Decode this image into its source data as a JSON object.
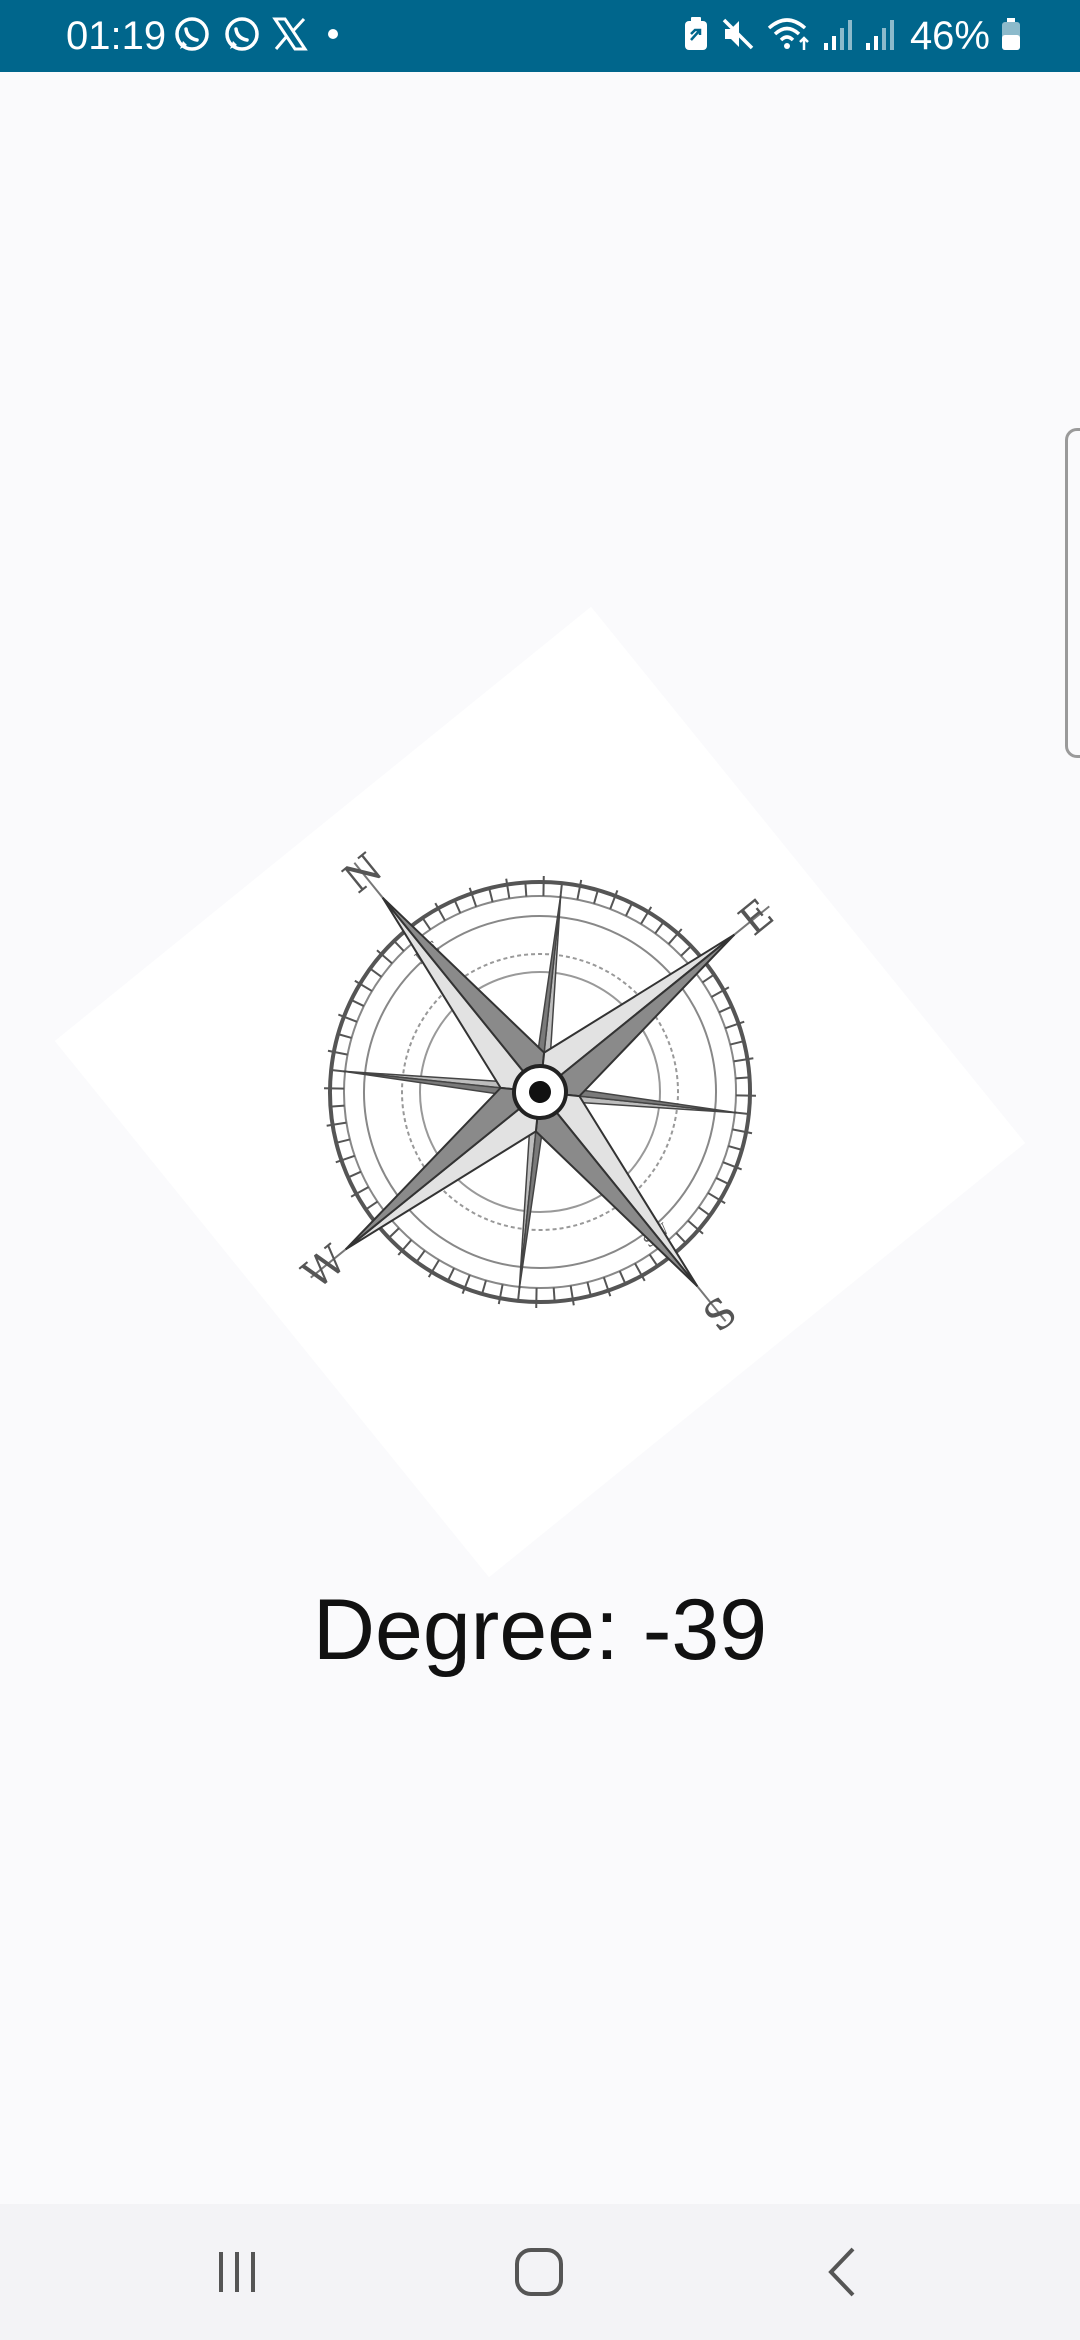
{
  "status_bar": {
    "time": "01:19",
    "battery": "46%",
    "background_color": "#00668c",
    "left_icons": [
      "whatsapp-icon",
      "whatsapp-icon",
      "x-icon",
      "notification-dot-icon"
    ],
    "right_icons": [
      "battery-saver-icon",
      "mute-icon",
      "wifi-icon",
      "signal-icon",
      "signal-icon",
      "battery-icon"
    ]
  },
  "compass": {
    "rotation_degrees": -39,
    "cardinal_labels": {
      "north": "N",
      "east": "E",
      "south": "S",
      "west": "W"
    }
  },
  "degree_label": "Degree: -39",
  "nav_bar": {
    "buttons": [
      "recent-apps",
      "home",
      "back"
    ]
  }
}
